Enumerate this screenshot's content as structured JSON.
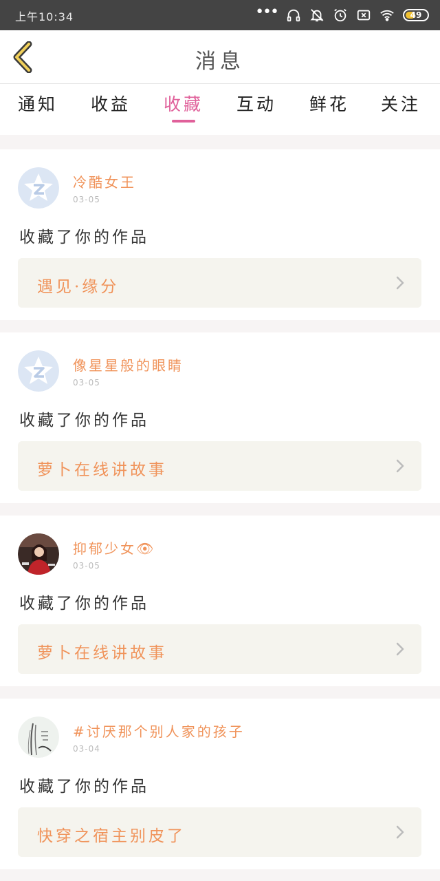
{
  "status_bar": {
    "time": "上午10:34",
    "battery": "49",
    "icons": [
      "more-dots-icon",
      "headphones-icon",
      "mute-bell-icon",
      "alarm-icon",
      "no-sim-icon",
      "wifi-icon",
      "battery-icon"
    ]
  },
  "header": {
    "title": "消息",
    "back_icon": "chevron-left-icon"
  },
  "tabs": [
    {
      "label": "通知",
      "active": false
    },
    {
      "label": "收益",
      "active": false
    },
    {
      "label": "收藏",
      "active": true
    },
    {
      "label": "互动",
      "active": false
    },
    {
      "label": "鲜花",
      "active": false
    },
    {
      "label": "关注",
      "active": false
    }
  ],
  "colors": {
    "accent_pink": "#e0609a",
    "orange_text": "#f0935a",
    "work_box_bg": "#f5f4ee",
    "page_bg": "#f7f4f4"
  },
  "items": [
    {
      "username": "冷酷女王",
      "date": "03-05",
      "action": "收藏了你的作品",
      "work_title": "遇见·缘分",
      "avatar": "default-qq-avatar"
    },
    {
      "username": "像星星般的眼睛",
      "date": "03-05",
      "action": "收藏了你的作品",
      "work_title": "萝卜在线讲故事",
      "avatar": "default-qq-avatar"
    },
    {
      "username": "抑郁少女👁",
      "date": "03-05",
      "action": "收藏了你的作品",
      "work_title": "萝卜在线讲故事",
      "avatar": "photo-avatar-girl"
    },
    {
      "username": "#讨厌那个别人家的孩子",
      "date": "03-04",
      "action": "收藏了你的作品",
      "work_title": "快穿之宿主别皮了",
      "avatar": "sketch-avatar"
    }
  ]
}
